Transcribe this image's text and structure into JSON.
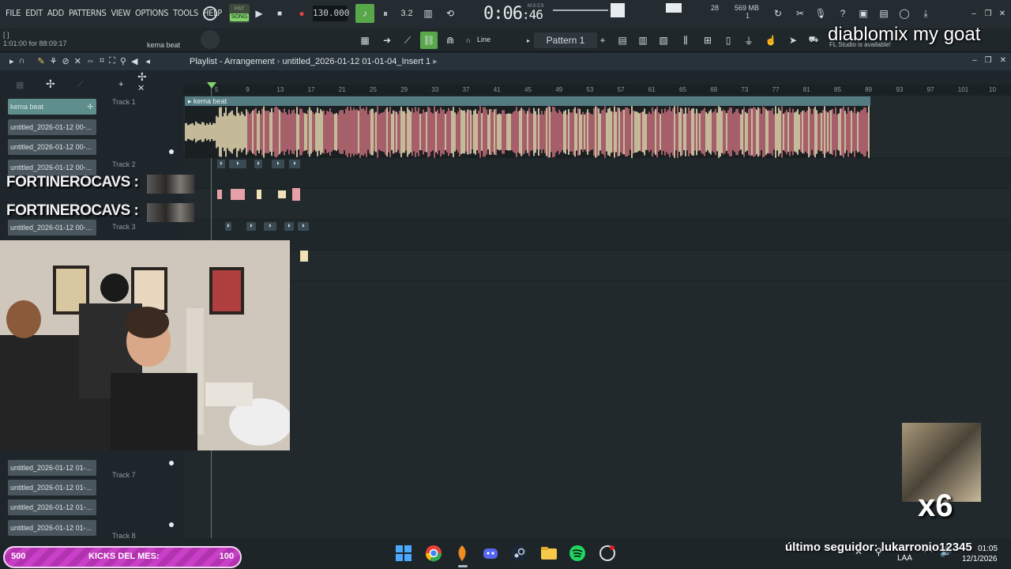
{
  "menu": [
    "FILE",
    "EDIT",
    "ADD",
    "PATTERNS",
    "VIEW",
    "OPTIONS",
    "TOOLS",
    "HELP"
  ],
  "transport": {
    "pat_label": "PAT",
    "song_label": "SONG",
    "tempo": "130.000",
    "time_main": "0:06",
    "time_sub": ":46",
    "time_unit": "M:S:CS",
    "snap_value": "3.2",
    "cpu_value": "28",
    "memory": "569 MB",
    "memory_sub": "1"
  },
  "row2": {
    "hint_line1": "[   ]",
    "hint_line2": "1:01:00 for 88:09:17",
    "song_name": "kema beat",
    "draw_mode": "Line",
    "pattern": "Pattern 1",
    "update_note": "FL Studio is available!"
  },
  "overlay_title": "diablomix my goat",
  "playlist": {
    "title_prefix": "Playlist - Arrangement",
    "title_file": "untitled_2026-01-12 01-01-04_Insert 1"
  },
  "picker": {
    "clips": [
      "kema beat",
      "untitled_2026-01-12 00-...",
      "untitled_2026-01-12 00-...",
      "untitled_2026-01-12 00-...",
      "untitled_2026-01-12 00-...",
      "untitled_2026-01-12 00-...",
      "untitled_2026-01-12 01-...",
      "untitled_2026-01-12 01-...",
      "untitled_2026-01-12 01-...",
      "untitled_2026-01-12 01-..."
    ],
    "tracks": [
      "Track 1",
      "Track 2",
      "Track 3",
      "Track 7",
      "Track 8"
    ]
  },
  "ruler": [
    "5",
    "9",
    "13",
    "17",
    "21",
    "25",
    "29",
    "33",
    "37",
    "41",
    "45",
    "49",
    "53",
    "57",
    "61",
    "65",
    "69",
    "73",
    "77",
    "81",
    "85",
    "89",
    "93",
    "97",
    "101",
    "10"
  ],
  "clip1_name": "kema beat",
  "overlays": {
    "fortine_1": "FORTINEROCAVS :",
    "fortine_2": "FORTINEROCAVS :",
    "combo": "x6"
  },
  "taskbar": {
    "kicks_left": "500",
    "kicks_label": "KICKS DEL MES:",
    "kicks_right": "100",
    "follower": "último seguidor: lukarronio12345",
    "lang": "LAA",
    "time": "01:05",
    "date": "12/1/2026"
  },
  "colors": {
    "accent_green": "#7fd36a",
    "waveform_pink": "#c9707c",
    "waveform_cream": "#efe2b9",
    "clip_header": "#547b82",
    "kicks_magenta": "#c93fc7"
  }
}
